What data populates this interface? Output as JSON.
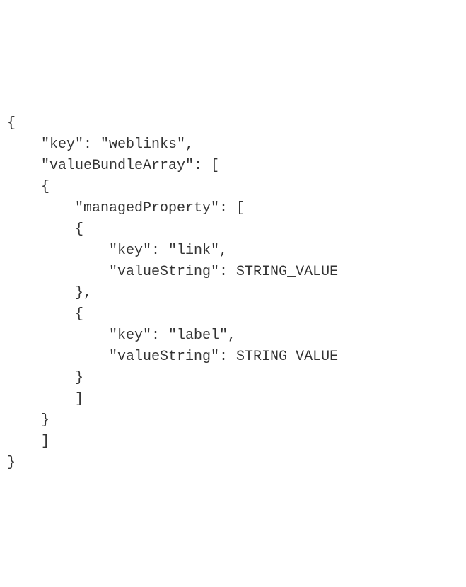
{
  "code": {
    "l1": "{",
    "l2": "    \"key\": \"weblinks\",",
    "l3": "    \"valueBundleArray\": [",
    "l4": "    {",
    "l5": "        \"managedProperty\": [",
    "l6": "        {",
    "l7": "            \"key\": \"link\",",
    "l8": "            \"valueString\": STRING_VALUE",
    "l9": "        },",
    "l10": "        {",
    "l11": "            \"key\": \"label\",",
    "l12": "            \"valueString\": STRING_VALUE",
    "l13": "        }",
    "l14": "        ]",
    "l15": "    }",
    "l16": "    ]",
    "l17": "}"
  }
}
